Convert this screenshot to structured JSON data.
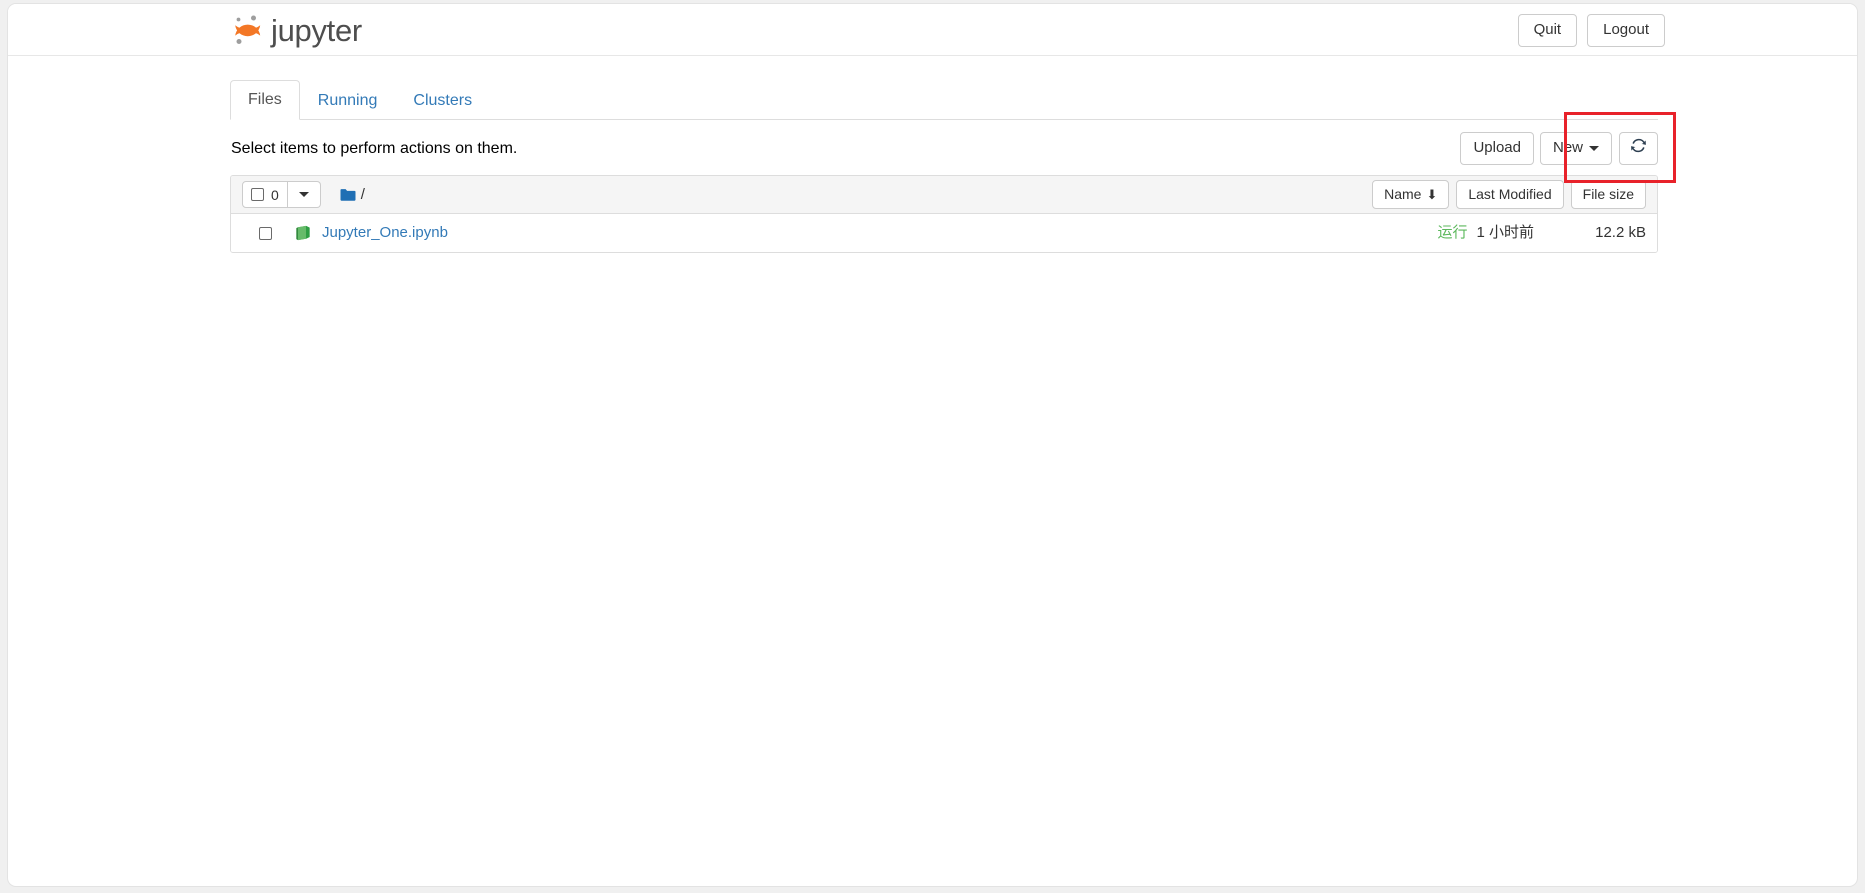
{
  "header": {
    "brand": "jupyter",
    "logo_icon": "jupyter-logo-icon",
    "quit_label": "Quit",
    "logout_label": "Logout"
  },
  "tabs": [
    {
      "label": "Files",
      "active": true
    },
    {
      "label": "Running",
      "active": false
    },
    {
      "label": "Clusters",
      "active": false
    }
  ],
  "actions": {
    "select_hint": "Select items to perform actions on them.",
    "upload_label": "Upload",
    "new_label": "New",
    "new_caret_icon": "chevron-down-icon",
    "refresh_icon": "refresh-icon",
    "highlight_color": "#e8222a"
  },
  "list_toolbar": {
    "select_all_count": "0",
    "select_all_caret_icon": "chevron-down-icon",
    "folder_icon": "folder-icon",
    "breadcrumb_path": "/",
    "sort_name": "Name",
    "sort_name_arrow": "⬇",
    "sort_modified": "Last Modified",
    "sort_filesize": "File size"
  },
  "files": [
    {
      "icon": "notebook-icon",
      "name": "Jupyter_One.ipynb",
      "status": "运行",
      "status_color": "#5cb85c",
      "modified": "1 小时前",
      "size": "12.2 kB"
    }
  ]
}
